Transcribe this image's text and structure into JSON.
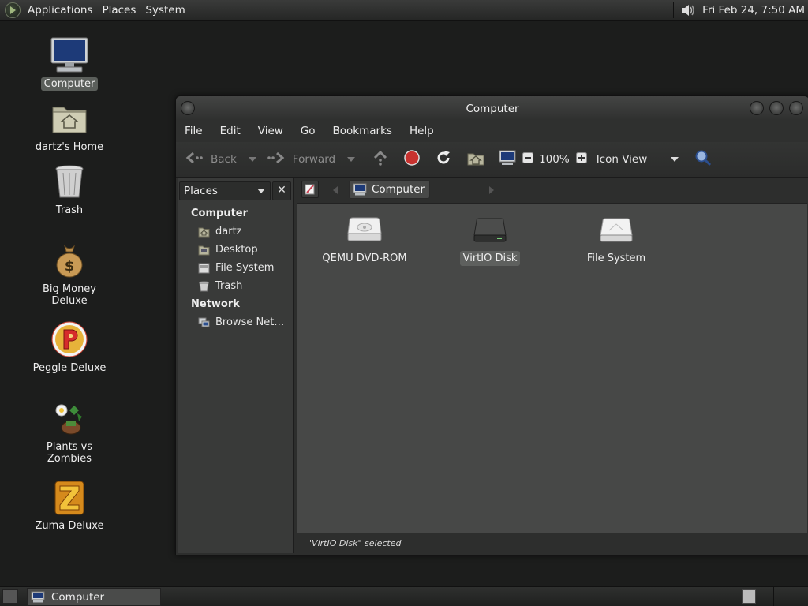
{
  "top_panel": {
    "menu": [
      "Applications",
      "Places",
      "System"
    ],
    "clock": "Fri Feb 24,  7:50 AM"
  },
  "desktop": {
    "icons": [
      {
        "label": "Computer",
        "icon": "computer-icon",
        "selected": true
      },
      {
        "label": "dartz's Home",
        "icon": "home-folder-icon"
      },
      {
        "label": "Trash",
        "icon": "trash-icon"
      },
      {
        "label": "Big Money Deluxe",
        "icon": "money-bag-icon"
      },
      {
        "label": "Peggle Deluxe",
        "icon": "peggle-icon"
      },
      {
        "label": "Plants vs Zombies",
        "icon": "plants-vs-zombies-icon"
      },
      {
        "label": "Zuma Deluxe",
        "icon": "zuma-icon"
      }
    ]
  },
  "window": {
    "title": "Computer",
    "menu": [
      "File",
      "Edit",
      "View",
      "Go",
      "Bookmarks",
      "Help"
    ],
    "toolbar": {
      "back": "Back",
      "forward": "Forward",
      "zoom": "100%",
      "view_mode": "Icon View"
    },
    "side_pane": {
      "selector": "Places",
      "close": "✕",
      "sections": [
        {
          "title": "Computer",
          "items": [
            "dartz",
            "Desktop",
            "File System",
            "Trash"
          ]
        },
        {
          "title": "Network",
          "items": [
            "Browse Net…"
          ]
        }
      ]
    },
    "location": {
      "crumb": "Computer"
    },
    "items": [
      {
        "label": "QEMU DVD-ROM",
        "icon": "optical-drive-icon"
      },
      {
        "label": "VirtIO Disk",
        "icon": "hard-disk-icon",
        "selected": true
      },
      {
        "label": "File System",
        "icon": "filesystem-drive-icon"
      }
    ],
    "status": "\"VirtIO Disk\" selected"
  },
  "bottom_panel": {
    "task": "Computer"
  },
  "colors": {
    "desktop_bg": "#1c1d1c",
    "window_bg": "#2d2e2d",
    "icon_view_bg": "#474847",
    "selection": "#5e605e",
    "stop_red": "#c8322f"
  }
}
